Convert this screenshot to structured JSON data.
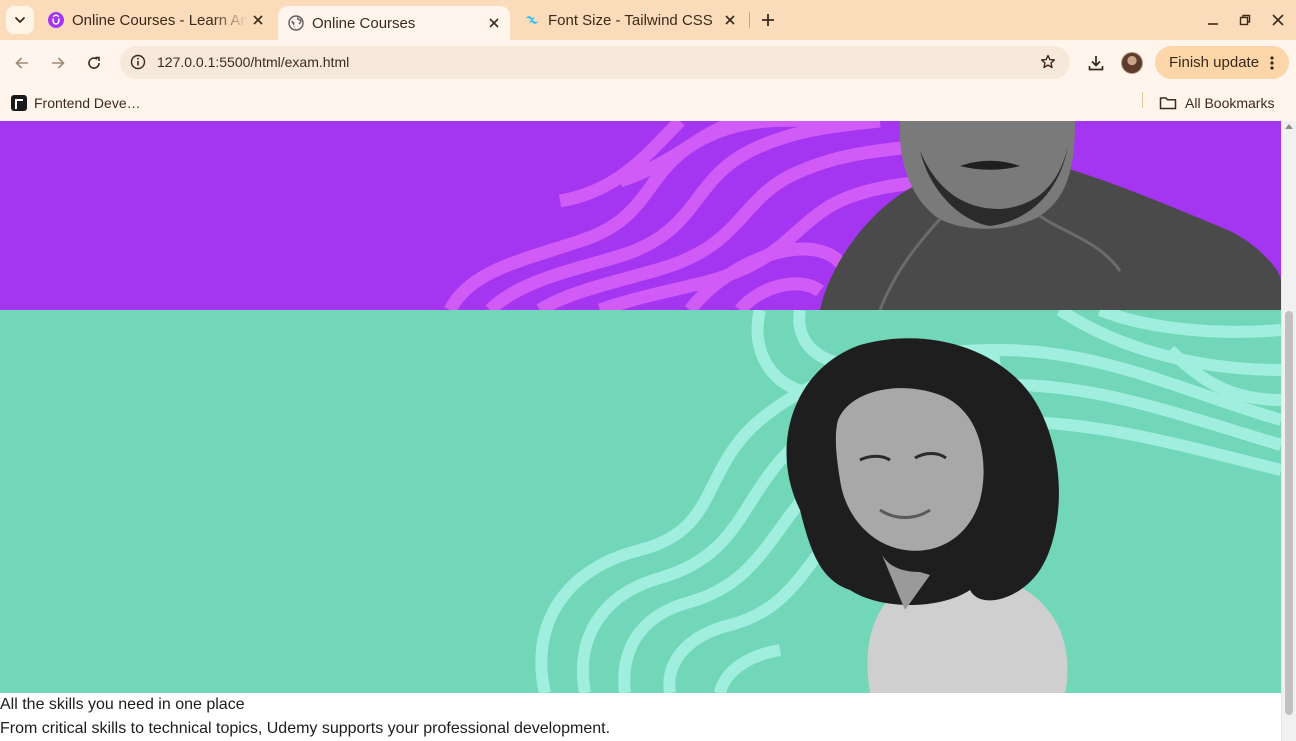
{
  "tabs": [
    {
      "title": "Online Courses - Learn Anything, On Your Schedule | Udemy",
      "favicon": "udemy-icon",
      "active": false
    },
    {
      "title": "Online Courses",
      "favicon": "globe-icon",
      "active": true
    },
    {
      "title": "Font Size - Tailwind CSS",
      "favicon": "tailwind-icon",
      "active": false
    }
  ],
  "toolbar": {
    "url": "127.0.0.1:5500/html/exam.html",
    "finish_update_label": "Finish update"
  },
  "bookmarks": {
    "items": [
      {
        "label": "Frontend Deve…"
      }
    ],
    "all_bookmarks_label": "All Bookmarks"
  },
  "page": {
    "headline": "All the skills you need in one place",
    "subline": "From critical skills to technical topics, Udemy supports your professional development."
  },
  "colors": {
    "tabstrip_bg": "#fbdcba",
    "toolbar_bg": "#fff5ec",
    "banner_purple": "#a435f0",
    "banner_purple_wave": "#d35ef8",
    "banner_teal": "#72d7b8",
    "banner_teal_wave": "#a3f1e1",
    "finish_update_bg": "#fcd5a8"
  }
}
